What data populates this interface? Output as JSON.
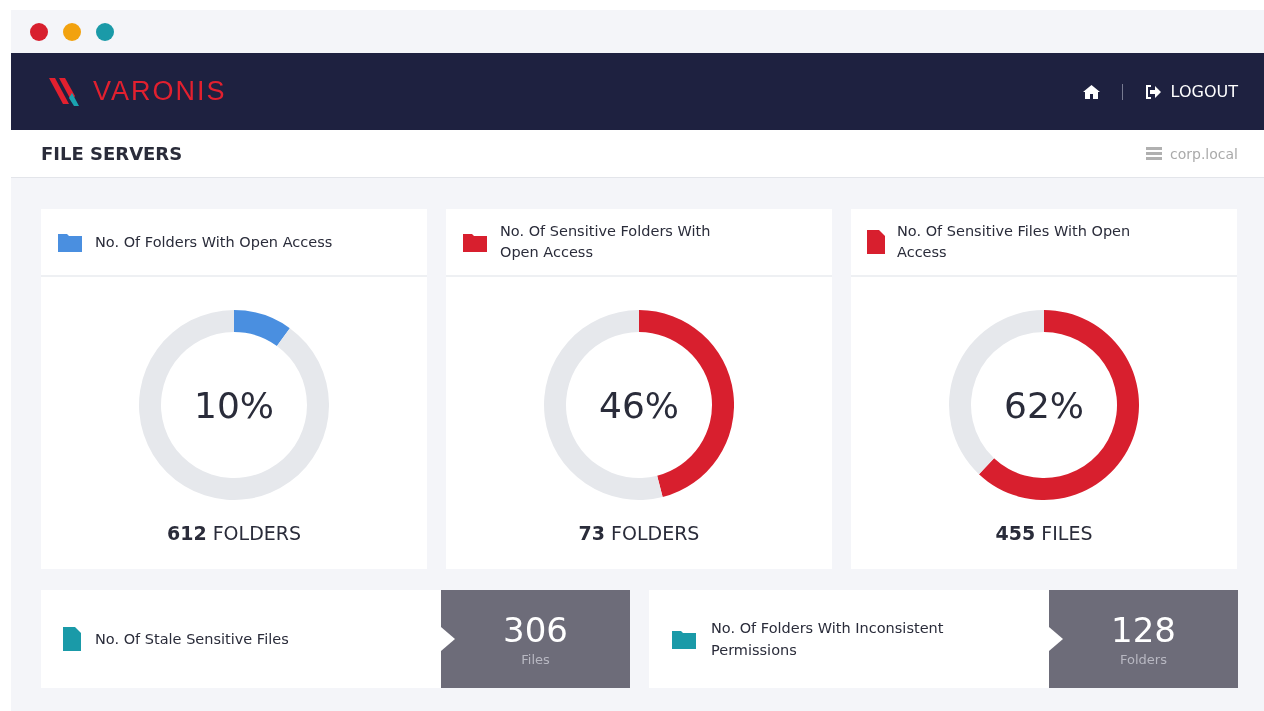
{
  "window": {
    "controls": [
      {
        "color": "#d81f2e"
      },
      {
        "color": "#f2a20f"
      },
      {
        "color": "#1a9aa8"
      }
    ]
  },
  "header": {
    "logo": "VARONIS",
    "nav": [
      {
        "kind": "home"
      },
      {
        "kind": "logout",
        "label": "LOGOUT"
      }
    ]
  },
  "page": {
    "title": "FILE SERVERS",
    "server": "corp.local"
  },
  "donut_cards": [
    {
      "title": "No. Of Folders With Open Access",
      "kind": "folder",
      "color": "#4a8fe0",
      "percent": "10%",
      "chart_data": {
        "type": "donut",
        "values": [
          10,
          90
        ]
      },
      "count": "**612** FOLDERS"
    },
    {
      "title": "No. Of Sensitive Folders With Open Access",
      "kind": "folder",
      "color": "#d81f2e",
      "percent": "46%",
      "chart_data": {
        "type": "donut",
        "values": [
          46,
          54
        ]
      },
      "count": "**73** FOLDERS"
    },
    {
      "title": "No. Of Sensitive Files With Open Access",
      "kind": "file",
      "color": "#d81f2e",
      "percent": "62%",
      "chart_data": {
        "type": "donut",
        "values": [
          62,
          38
        ]
      },
      "count": "**455** FILES"
    }
  ],
  "stat_cards": [
    {
      "title": "No. Of Stale Sensitive Files",
      "kind": "file",
      "color": "#1a9aa8",
      "value": "306",
      "unit": "Files"
    },
    {
      "title": "No. Of Folders With Inconsistent Permissions",
      "kind": "folder",
      "color": "#1a9aa8",
      "value": "128",
      "unit": "Folders"
    }
  ]
}
